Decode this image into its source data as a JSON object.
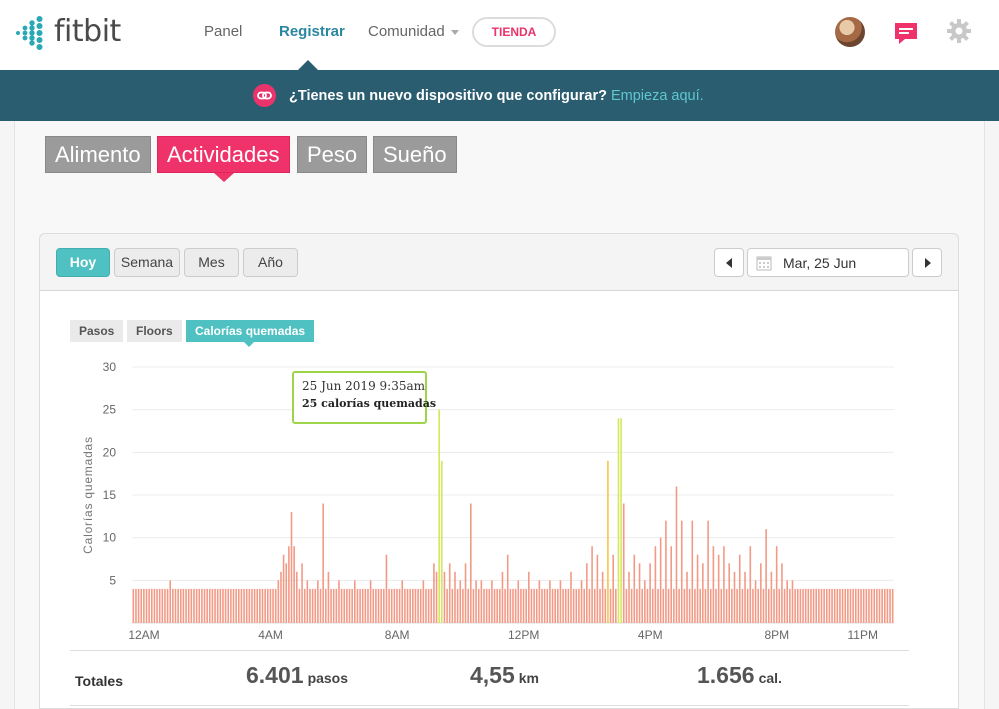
{
  "header": {
    "logo_text": "fitbit",
    "nav": [
      {
        "label": "Panel"
      },
      {
        "label": "Registrar",
        "active": true
      },
      {
        "label": "Comunidad"
      }
    ],
    "store_label": "TIENDA",
    "icons": [
      "avatar",
      "messages-icon",
      "gear-icon"
    ]
  },
  "banner": {
    "text": "¿Tienes un nuevo dispositivo que configurar?",
    "link": "Empieza aquí."
  },
  "category_tabs": [
    "Alimento",
    "Actividades",
    "Peso",
    "Sueño"
  ],
  "active_category": "Actividades",
  "period_buttons": [
    "Hoy",
    "Semana",
    "Mes",
    "Año"
  ],
  "active_period": "Hoy",
  "date": "Mar, 25 Jun",
  "metric_chips": [
    "Pasos",
    "Floors",
    "Calorías quemadas"
  ],
  "active_metric": "Calorías quemadas",
  "tooltip": {
    "date": "25 Jun 2019 9:35am",
    "value": "25 calorías quemadas"
  },
  "totals": {
    "label": "Totales",
    "steps_value": "6.401",
    "steps_unit": "pasos",
    "distance_value": "4,55",
    "distance_unit": "km",
    "calories_value": "1.656",
    "calories_unit": "cal."
  },
  "colors": {
    "accent_pink": "#f0326b",
    "teal": "#4fc1c3",
    "banner_bg": "#2b5d70",
    "bar_normal": "#f29a86",
    "bar_active": "#f5c64a",
    "bar_peak": "#d4e85a"
  },
  "chart_data": {
    "type": "bar",
    "ylabel": "Calorías quemadas",
    "ylim": [
      0,
      30
    ],
    "yticks": [
      5,
      10,
      15,
      20,
      25,
      30
    ],
    "xticks": [
      "12AM",
      "4AM",
      "8AM",
      "12PM",
      "4PM",
      "8PM",
      "11PM"
    ],
    "bucket_minutes": 5,
    "grid": true,
    "series": [
      {
        "values": [
          4,
          4,
          4,
          4,
          4,
          4,
          4,
          4,
          4,
          4,
          4,
          4,
          4,
          4,
          5,
          4,
          4,
          4,
          4,
          4,
          4,
          4,
          4,
          4,
          4,
          4,
          4,
          4,
          4,
          4,
          4,
          4,
          4,
          4,
          4,
          4,
          4,
          4,
          4,
          4,
          4,
          4,
          4,
          4,
          4,
          4,
          4,
          4,
          4,
          4,
          4,
          4,
          4,
          4,
          4,
          4,
          4,
          4,
          4,
          4,
          4,
          4,
          4,
          4,
          4,
          4,
          4,
          4,
          4,
          4,
          4,
          4,
          4,
          4,
          4,
          4,
          4,
          4,
          4,
          4,
          4,
          4,
          4,
          4,
          4,
          4,
          4,
          4,
          4,
          4,
          4,
          4,
          4,
          4,
          4,
          4,
          4,
          4,
          4,
          4,
          4,
          4,
          4,
          4,
          4,
          4,
          4,
          4,
          4,
          4,
          4,
          4,
          4,
          4,
          4,
          4,
          4,
          4,
          4,
          4,
          4,
          4,
          4,
          4,
          4,
          4,
          4,
          4,
          4,
          4,
          4,
          4,
          4,
          4,
          4,
          4,
          4,
          4,
          4,
          4,
          4,
          4,
          4,
          4,
          4,
          4,
          4,
          4,
          4,
          4,
          4,
          4,
          4,
          4,
          4,
          4,
          4,
          4,
          4,
          4,
          4,
          4,
          4,
          4,
          4,
          4,
          4,
          4,
          4,
          4,
          4,
          4,
          4,
          4,
          4,
          4,
          4,
          4,
          4,
          4,
          4,
          4,
          4,
          4,
          4,
          4,
          4,
          4,
          4,
          4,
          4,
          4,
          4,
          4,
          4,
          4,
          4,
          4,
          4,
          4,
          4,
          4,
          4,
          4,
          4,
          4,
          4,
          4,
          4,
          4,
          4,
          4,
          4,
          4,
          4,
          4,
          4,
          4,
          4,
          4,
          4,
          4,
          4,
          4,
          4,
          4,
          4,
          4,
          4,
          4,
          4,
          4,
          4,
          4,
          4,
          4,
          4,
          4,
          4,
          4,
          4,
          4,
          4,
          4,
          4,
          4,
          4,
          4,
          4,
          4,
          4,
          4,
          4,
          4,
          4,
          4,
          4,
          4,
          4,
          4,
          4,
          4,
          4,
          4,
          4,
          4,
          4,
          4,
          4,
          4,
          4,
          4,
          4,
          4,
          4,
          4,
          4,
          4,
          4,
          4,
          4,
          4,
          4,
          4,
          4,
          4,
          4,
          4,
          4
        ]
      }
    ],
    "overrides": [
      {
        "index": 55,
        "value": 5
      },
      {
        "index": 56,
        "value": 6
      },
      {
        "index": 57,
        "value": 8
      },
      {
        "index": 58,
        "value": 7
      },
      {
        "index": 59,
        "value": 9
      },
      {
        "index": 60,
        "value": 13
      },
      {
        "index": 61,
        "value": 9
      },
      {
        "index": 62,
        "value": 6
      },
      {
        "index": 64,
        "value": 7
      },
      {
        "index": 66,
        "value": 5
      },
      {
        "index": 70,
        "value": 5
      },
      {
        "index": 72,
        "value": 14
      },
      {
        "index": 74,
        "value": 6
      },
      {
        "index": 78,
        "value": 5
      },
      {
        "index": 84,
        "value": 5
      },
      {
        "index": 90,
        "value": 5
      },
      {
        "index": 96,
        "value": 8
      },
      {
        "index": 102,
        "value": 5
      },
      {
        "index": 110,
        "value": 5
      },
      {
        "index": 114,
        "value": 7
      },
      {
        "index": 115,
        "value": 6
      },
      {
        "index": 116,
        "value": 25,
        "peak": true
      },
      {
        "index": 117,
        "value": 19,
        "peak": true
      },
      {
        "index": 118,
        "value": 6
      },
      {
        "index": 120,
        "value": 7
      },
      {
        "index": 122,
        "value": 6
      },
      {
        "index": 124,
        "value": 5
      },
      {
        "index": 126,
        "value": 7
      },
      {
        "index": 128,
        "value": 14
      },
      {
        "index": 130,
        "value": 5
      },
      {
        "index": 132,
        "value": 5
      },
      {
        "index": 136,
        "value": 5
      },
      {
        "index": 140,
        "value": 6
      },
      {
        "index": 142,
        "value": 8
      },
      {
        "index": 146,
        "value": 5
      },
      {
        "index": 150,
        "value": 6
      },
      {
        "index": 154,
        "value": 5
      },
      {
        "index": 158,
        "value": 5
      },
      {
        "index": 162,
        "value": 5
      },
      {
        "index": 166,
        "value": 6
      },
      {
        "index": 170,
        "value": 5
      },
      {
        "index": 172,
        "value": 7
      },
      {
        "index": 174,
        "value": 9
      },
      {
        "index": 176,
        "value": 8
      },
      {
        "index": 178,
        "value": 6
      },
      {
        "index": 180,
        "value": 19,
        "active": true
      },
      {
        "index": 182,
        "value": 8
      },
      {
        "index": 184,
        "value": 24,
        "peak": true
      },
      {
        "index": 185,
        "value": 24,
        "peak": true
      },
      {
        "index": 186,
        "value": 14
      },
      {
        "index": 188,
        "value": 6
      },
      {
        "index": 190,
        "value": 8
      },
      {
        "index": 192,
        "value": 7
      },
      {
        "index": 194,
        "value": 5
      },
      {
        "index": 196,
        "value": 7
      },
      {
        "index": 198,
        "value": 9
      },
      {
        "index": 200,
        "value": 10
      },
      {
        "index": 202,
        "value": 12
      },
      {
        "index": 204,
        "value": 9
      },
      {
        "index": 206,
        "value": 16
      },
      {
        "index": 208,
        "value": 12
      },
      {
        "index": 210,
        "value": 6
      },
      {
        "index": 212,
        "value": 12
      },
      {
        "index": 214,
        "value": 8
      },
      {
        "index": 216,
        "value": 7
      },
      {
        "index": 218,
        "value": 12
      },
      {
        "index": 220,
        "value": 9
      },
      {
        "index": 222,
        "value": 8
      },
      {
        "index": 224,
        "value": 9
      },
      {
        "index": 226,
        "value": 7
      },
      {
        "index": 228,
        "value": 6
      },
      {
        "index": 230,
        "value": 8
      },
      {
        "index": 232,
        "value": 6
      },
      {
        "index": 234,
        "value": 9
      },
      {
        "index": 236,
        "value": 5
      },
      {
        "index": 238,
        "value": 7
      },
      {
        "index": 240,
        "value": 11
      },
      {
        "index": 242,
        "value": 6
      },
      {
        "index": 244,
        "value": 9
      },
      {
        "index": 246,
        "value": 7
      },
      {
        "index": 248,
        "value": 5
      },
      {
        "index": 250,
        "value": 5
      }
    ]
  }
}
